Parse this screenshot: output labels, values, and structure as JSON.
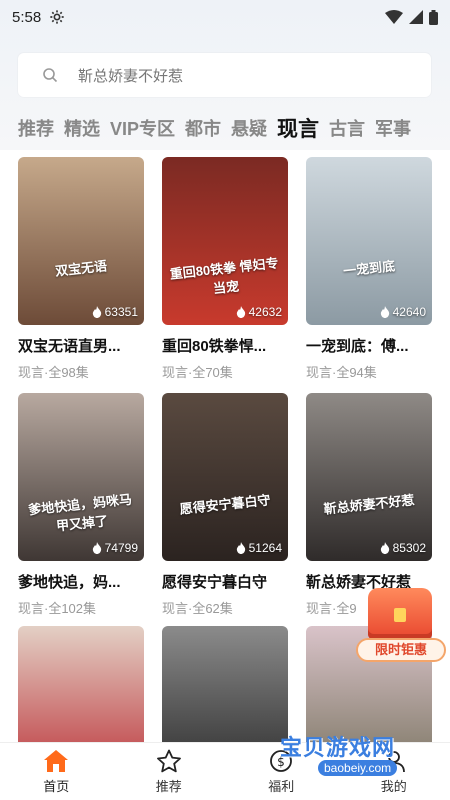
{
  "status_bar": {
    "time": "5:58"
  },
  "search": {
    "placeholder": "靳总娇妻不好惹"
  },
  "tabs": [
    "推荐",
    "精选",
    "VIP专区",
    "都市",
    "悬疑",
    "现言",
    "古言",
    "军事"
  ],
  "active_tab": "现言",
  "cards": [
    {
      "title": "双宝无语直男...",
      "meta": "现言·全98集",
      "poster_text": "双宝无语",
      "heat": "63351",
      "color_top": "#c6a98b",
      "color_bottom": "#6d4b38"
    },
    {
      "title": "重回80铁拳悍...",
      "meta": "现言·全70集",
      "poster_text": "重回80铁拳 悍妇专当宠",
      "heat": "42632",
      "color_top": "#7b2a23",
      "color_bottom": "#c83a2d"
    },
    {
      "title": "一宠到底：傅...",
      "meta": "现言·全94集",
      "poster_text": "一宠到底",
      "heat": "42640",
      "color_top": "#cfd8de",
      "color_bottom": "#8c9aa3"
    },
    {
      "title": "爹地快追，妈...",
      "meta": "现言·全102集",
      "poster_text": "爹地快追，妈咪马甲又掉了",
      "heat": "74799",
      "color_top": "#b8a9a0",
      "color_bottom": "#3f3734"
    },
    {
      "title": "愿得安宁暮白守",
      "meta": "现言·全62集",
      "poster_text": "愿得安宁暮白守",
      "heat": "51264",
      "color_top": "#5a4a40",
      "color_bottom": "#2b2320"
    },
    {
      "title": "靳总娇妻不好惹",
      "meta": "现言·全9",
      "poster_text": "靳总娇妻不好惹",
      "heat": "85302",
      "color_top": "#8f8a86",
      "color_bottom": "#2f2b2a"
    },
    {
      "title": "",
      "meta": "",
      "poster_text": "",
      "heat": "",
      "color_top": "#e3d0c5",
      "color_bottom": "#b9282f"
    },
    {
      "title": "",
      "meta": "",
      "poster_text": "",
      "heat": "",
      "color_top": "#8b8b8b",
      "color_bottom": "#242424"
    },
    {
      "title": "",
      "meta": "",
      "poster_text": "",
      "heat": "",
      "color_top": "#d9c3c9",
      "color_bottom": "#6f6b55"
    }
  ],
  "promo": {
    "label": "限时钜惠"
  },
  "bottom_nav": [
    {
      "label": "首页",
      "icon": "home-icon"
    },
    {
      "label": "推荐",
      "icon": "star-icon"
    },
    {
      "label": "福利",
      "icon": "gift-icon"
    },
    {
      "label": "我的",
      "icon": "user-icon"
    }
  ],
  "watermark": {
    "text": "宝贝游戏网",
    "url": "baobeiy.com"
  },
  "colors": {
    "accent": "#ff6a1a",
    "text": "#111111",
    "muted": "#999999"
  }
}
